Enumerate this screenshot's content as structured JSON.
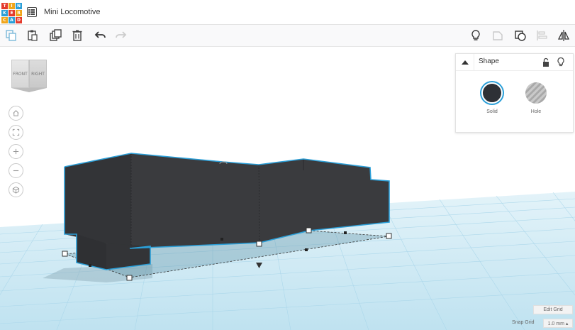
{
  "app": {
    "logo_letters": [
      "T",
      "I",
      "N",
      "K",
      "E",
      "R",
      "C",
      "A",
      "D"
    ],
    "logo_colors": [
      "#e43a2c",
      "#f0a51b",
      "#2b9fd8",
      "#2b9fd8",
      "#e43a2c",
      "#f0a51b",
      "#f0a51b",
      "#2b9fd8",
      "#e43a2c"
    ],
    "document_title": "Mini Locomotive"
  },
  "toolbar": {
    "left_icons": [
      "copy-icon",
      "paste-icon",
      "duplicate-icon",
      "delete-icon",
      "undo-icon",
      "redo-icon"
    ],
    "right_icons": [
      "lightbulb-icon",
      "note-icon",
      "group-icon",
      "align-icon",
      "mirror-icon"
    ]
  },
  "viewcube": {
    "front_label": "FRONT",
    "right_label": "RIGHT"
  },
  "nav": {
    "icons": [
      "home-icon",
      "fit-view-icon",
      "zoom-in-icon",
      "zoom-out-icon",
      "perspective-icon"
    ]
  },
  "shape_panel": {
    "title": "Shape",
    "solid_label": "Solid",
    "hole_label": "Hole",
    "solid_color": "#2e3136",
    "selection_color": "#2b9fd8"
  },
  "grid": {
    "edit_label": "Edit Grid",
    "snap_label": "Snap Grid",
    "snap_value": "1.0 mm ▴"
  },
  "colors": {
    "workplane": "#c8e6f2",
    "grid_line": "#a9d6ea",
    "object": "#3a3b3e",
    "selection": "#2b9fd8"
  }
}
